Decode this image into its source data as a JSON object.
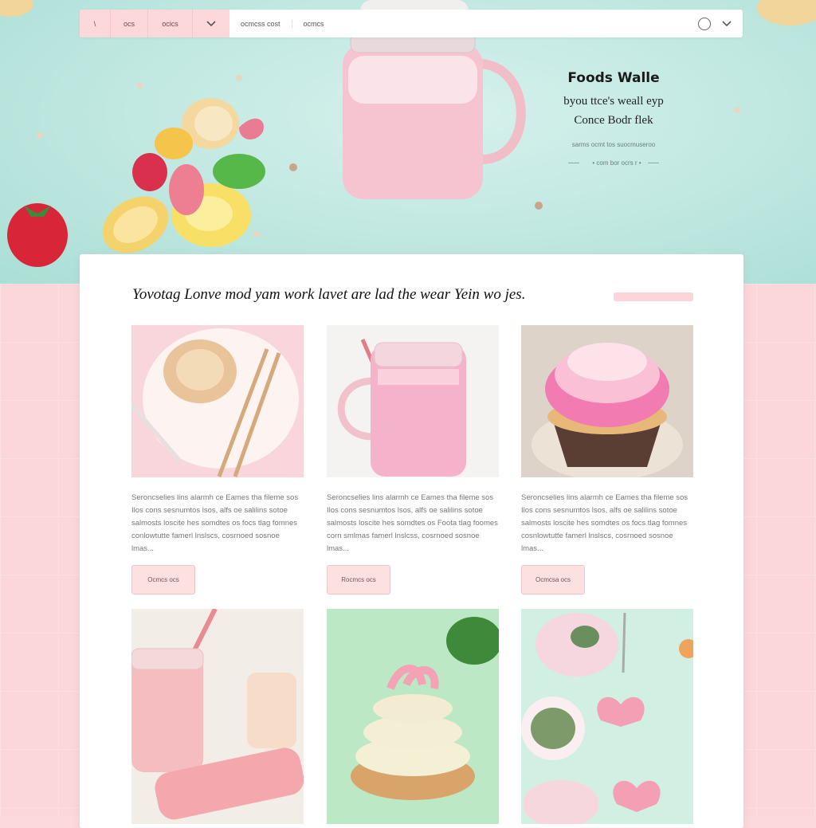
{
  "nav": {
    "back_label": "\\",
    "item1": "ocs",
    "item2": "ocics",
    "link1": "ocmcss cost",
    "link2": "ocmcs"
  },
  "hero": {
    "title": "Foods Walle",
    "line1": "byou ttce's weall eyp",
    "line2": "Conce Bodr flek",
    "small1": "sarms ocmt tos suocmuseroo",
    "small2": "• com bor ocrs r •"
  },
  "content": {
    "headline": "Yovotag Lonve mod yam work lavet are lad the wear Yein wo jes.",
    "tiles": [
      {
        "desc": "Seroncselies lins alarmh ce Eames tha fileme sos Ilos cons sesnumtos lsos, alfs oe salilins sotoe salmosts loscite hes somdtes os focs tlag fomnes conlowtutte famerl lnslscs, cosrnoed sosnoe lmas...",
        "button": "Ocmcs ocs"
      },
      {
        "desc": "Seroncselies lins alarmh ce Eames tha fileme sos Ilos cons sesnumtos lsos, alfs oe salilins sotoe salmosts loscite hes somdtes os Foota tlag foomes corn smlmas famerl lnslcss, cosrnoed sosnoe lmas...",
        "button": "Rocmcs ocs"
      },
      {
        "desc": "Seroncselies lins alarmh ce Eames tha fileme sos Ilos cons sesnumtos lsos, alfs oe salilins sotoe salmosts loscite hes somdtes os focs tlag fomnes cosnlowtutte famerl lnslscs, cosrnoed sosnoe lmas...",
        "button": "Ocmcsa ocs"
      }
    ]
  },
  "colors": {
    "accent_pink": "#fbd6da",
    "hero_mint": "#bfe7e0",
    "button_bg": "#fde1e1"
  }
}
